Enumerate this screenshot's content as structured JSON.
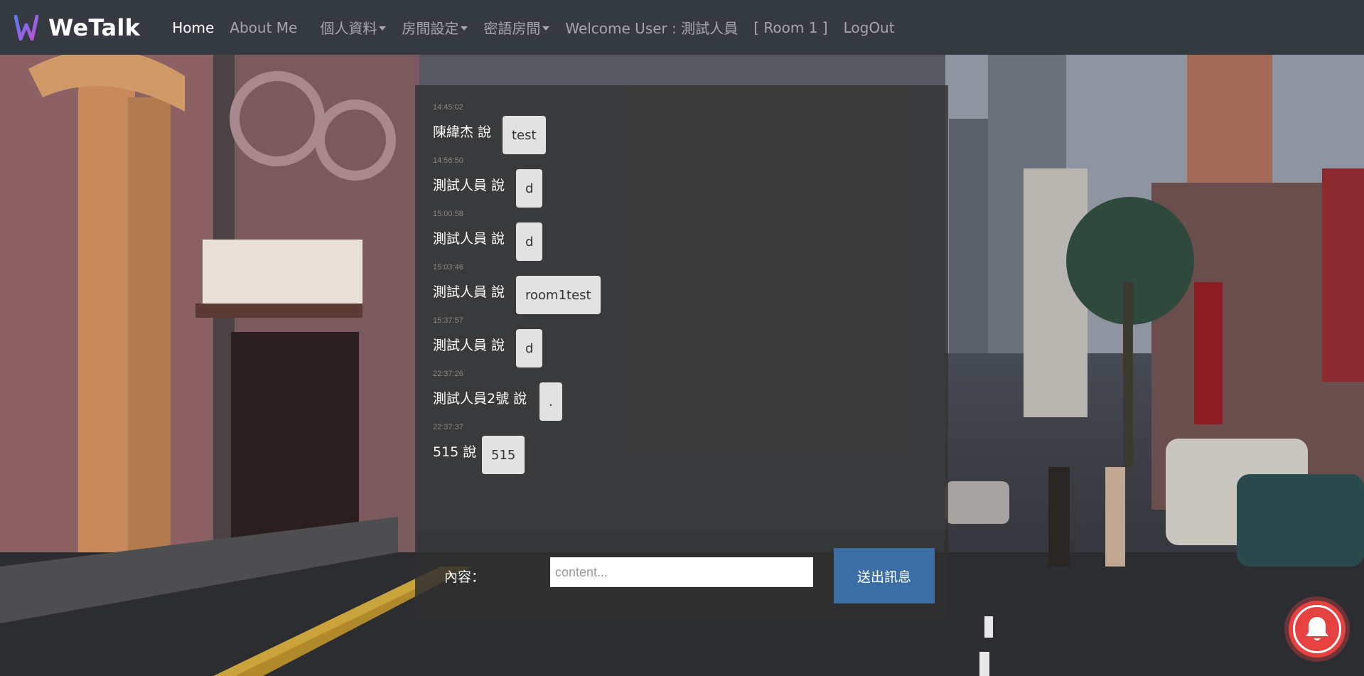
{
  "navbar": {
    "brand": "WeTalk",
    "links": {
      "home": "Home",
      "about": "About Me",
      "profile": "個人資料",
      "room_settings": "房間設定",
      "private_rooms": "密語房間",
      "welcome": "Welcome User : 測試人員",
      "room": "[ Room 1 ]",
      "logout": "LogOut"
    }
  },
  "chat": {
    "messages": [
      {
        "time": "14:45:02",
        "sender": "陳緯杰 說",
        "text": "test"
      },
      {
        "time": "14:56:50",
        "sender": "測試人員 說",
        "text": "d"
      },
      {
        "time": "15:00:58",
        "sender": "測試人員 說",
        "text": "d"
      },
      {
        "time": "15:03:46",
        "sender": "測試人員 說",
        "text": "room1test"
      },
      {
        "time": "15:37:57",
        "sender": "測試人員 說",
        "text": "d"
      },
      {
        "time": "22:37:26",
        "sender": "測試人員2號 說",
        "text": "."
      },
      {
        "time": "22:37:37",
        "sender": "515 說",
        "text": "515"
      }
    ],
    "composer": {
      "label": "內容：",
      "placeholder": "content...",
      "send_label": "送出訊息"
    }
  },
  "colors": {
    "navbar_bg": "#343a40",
    "send_button": "#3b6ea5",
    "notification_button": "#e54141"
  },
  "icons": {
    "brand": "w-logo-icon",
    "notification": "bell-icon"
  }
}
